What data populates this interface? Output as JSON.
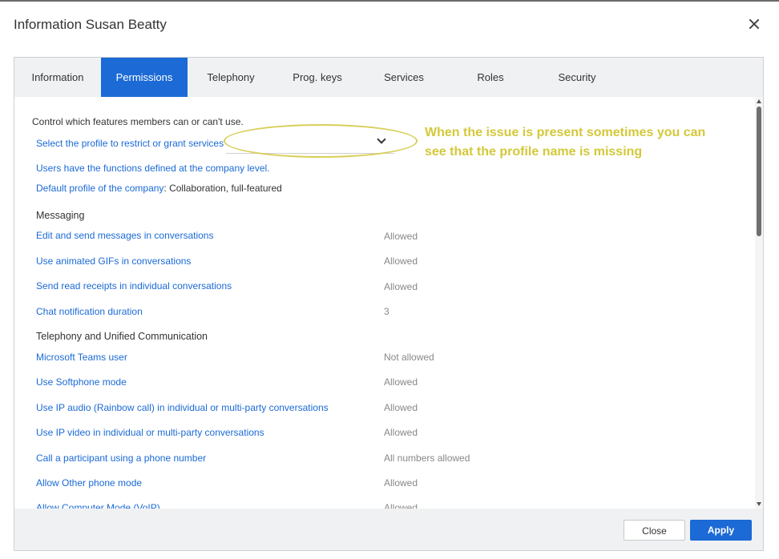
{
  "dialog": {
    "title": "Information Susan Beatty"
  },
  "tabs": [
    {
      "label": "Information"
    },
    {
      "label": "Permissions",
      "active": true
    },
    {
      "label": "Telephony"
    },
    {
      "label": "Prog. keys"
    },
    {
      "label": "Services"
    },
    {
      "label": "Roles"
    },
    {
      "label": "Security"
    }
  ],
  "permissions": {
    "intro": "Control which features members can or can't use.",
    "profile_select_label": "Select the profile to restrict or grant services",
    "profile_select_value": "",
    "company_level_note": "Users have the functions defined at the company level.",
    "default_profile_label": "Default profile of the company",
    "default_profile_value": ": Collaboration, full-featured",
    "annotation": "When the issue is present sometimes you can see that the profile name is missing",
    "sections": [
      {
        "title": "Messaging",
        "rows": [
          {
            "label": "Edit and send messages in conversations",
            "value": "Allowed"
          },
          {
            "label": "Use animated GIFs in conversations",
            "value": "Allowed"
          },
          {
            "label": "Send read receipts in individual conversations",
            "value": "Allowed"
          },
          {
            "label": "Chat notification duration",
            "value": "3"
          }
        ]
      },
      {
        "title": "Telephony and Unified Communication",
        "rows": [
          {
            "label": "Microsoft Teams user",
            "value": "Not allowed"
          },
          {
            "label": "Use Softphone mode",
            "value": "Allowed"
          },
          {
            "label": "Use IP audio (Rainbow call) in individual or multi-party conversations",
            "value": "Allowed"
          },
          {
            "label": "Use IP video in individual or multi-party conversations",
            "value": "Allowed"
          },
          {
            "label": "Call a participant using a phone number",
            "value": "All numbers allowed"
          },
          {
            "label": "Allow Other phone mode",
            "value": "Allowed"
          },
          {
            "label": "Allow Computer Mode (VoIP)",
            "value": "Allowed"
          }
        ]
      }
    ]
  },
  "footer": {
    "close_label": "Close",
    "apply_label": "Apply"
  },
  "colors": {
    "accent": "#1b6ad6",
    "annotation": "#d4c83a",
    "panel_bg": "#f0f1f3"
  }
}
